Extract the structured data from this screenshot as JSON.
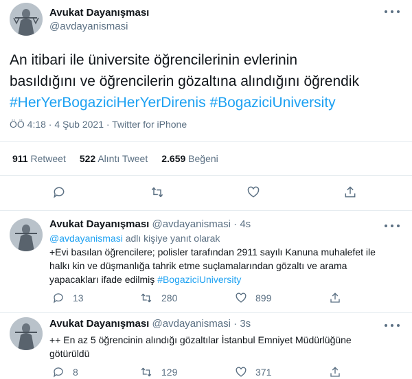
{
  "main_tweet": {
    "author_name": "Avukat Dayanışması",
    "author_handle": "@avdayanismasi",
    "text_line1": "An itibari ile üniversite öğrencilerinin evlerinin",
    "text_line2": "basıldığını ve öğrencilerin gözaltına alındığını öğrendik",
    "hashtag1": "#HerYerBogaziciHerYerDirenis",
    "hashtag2": "#BogaziciUniversity",
    "meta": "ÖÖ 4:18 · 4 Şub 2021 · Twitter for iPhone",
    "retweets_count": "911",
    "retweets_label": "Retweet",
    "quotes_count": "522",
    "quotes_label": "Alıntı Tweet",
    "likes_count": "2.659",
    "likes_label": "Beğeni"
  },
  "replies": [
    {
      "author_name": "Avukat Dayanışması",
      "author_handle": "@avdayanismasi",
      "time": "4s",
      "reply_to_mention": "@avdayanismasi",
      "reply_to_suffix": "adlı kişiye yanıt olarak",
      "text_line1": "+Evi basılan öğrencilere; polisler tarafından 2911 sayılı Kanuna muhalefet ile",
      "text_line2": "halkı kin ve düşmanlığa tahrik etme suçlamalarından gözaltı ve arama",
      "text_line3": "yapacakları ifade edilmiş",
      "hashtag": "#BogaziciUniversity",
      "reply_count": "13",
      "retweet_count": "280",
      "like_count": "899"
    },
    {
      "author_name": "Avukat Dayanışması",
      "author_handle": "@avdayanismasi",
      "time": "3s",
      "text_line1": "++ En az 5 öğrencinin alındığı gözaltılar İstanbul Emniyet Müdürlüğüne",
      "text_line2": "götürüldü",
      "reply_count": "8",
      "retweet_count": "129",
      "like_count": "371"
    }
  ],
  "colors": {
    "link": "#1da1f2",
    "muted": "#5b7083",
    "text": "#0f1419",
    "divider": "#e6ecf0"
  },
  "icons": [
    "avatar-statue",
    "more-icon",
    "reply-icon",
    "retweet-icon",
    "like-icon",
    "share-icon"
  ]
}
